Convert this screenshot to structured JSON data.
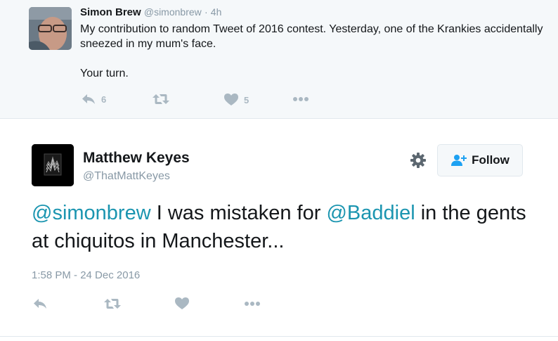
{
  "parent_tweet": {
    "name": "Simon Brew",
    "handle": "@simonbrew",
    "separator": "·",
    "time": "4h",
    "text_line1": "My contribution to random Tweet of 2016 contest. Yesterday, one of the Krankies accidentally sneezed in my mum's face.",
    "text_line2": "Your turn.",
    "reply_count": "6",
    "like_count": "5"
  },
  "main_tweet": {
    "name": "Matthew Keyes",
    "handle": "@ThatMattKeyes",
    "follow_label": "Follow",
    "mention1": "@simonbrew",
    "text_middle": " I was mistaken for ",
    "mention2": "@Baddiel",
    "text_end": " in the gents at chiquitos in Manchester...",
    "timestamp": "1:58 PM - 24 Dec 2016"
  },
  "colors": {
    "link": "#1b95b0",
    "action_icon": "#aab8c2",
    "follow_icon": "#1da1f2",
    "background_parent": "#f5f8fa"
  },
  "icons": [
    "reply-icon",
    "retweet-icon",
    "heart-icon",
    "more-icon",
    "gear-icon",
    "follow-person-icon"
  ]
}
